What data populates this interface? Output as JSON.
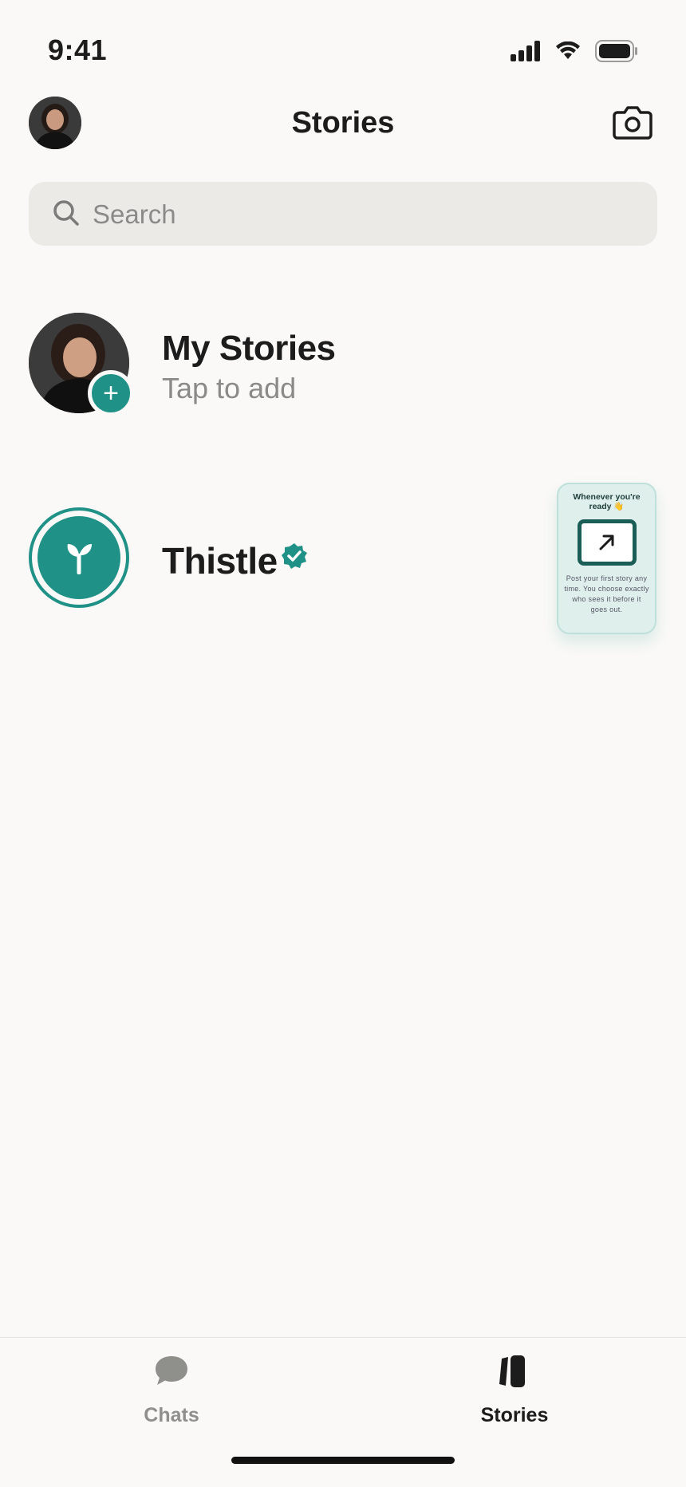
{
  "status_bar": {
    "time": "9:41"
  },
  "header": {
    "title": "Stories"
  },
  "search": {
    "placeholder": "Search"
  },
  "my_stories": {
    "title": "My Stories",
    "subtitle": "Tap to add",
    "add_glyph": "+"
  },
  "channels": [
    {
      "name": "Thistle",
      "verified": true
    }
  ],
  "tip_card": {
    "title": "Whenever you're ready 👋",
    "body": "Post your first story any time. You choose exactly who sees it before it goes out."
  },
  "tab_bar": {
    "tabs": [
      {
        "label": "Chats",
        "icon": "chat-bubble-icon",
        "active": false
      },
      {
        "label": "Stories",
        "icon": "stories-icon",
        "active": true
      }
    ]
  },
  "colors": {
    "accent": "#1f9187",
    "background": "#faf9f7",
    "search_bg": "#ebeae6",
    "muted_text": "#8a8a88"
  }
}
